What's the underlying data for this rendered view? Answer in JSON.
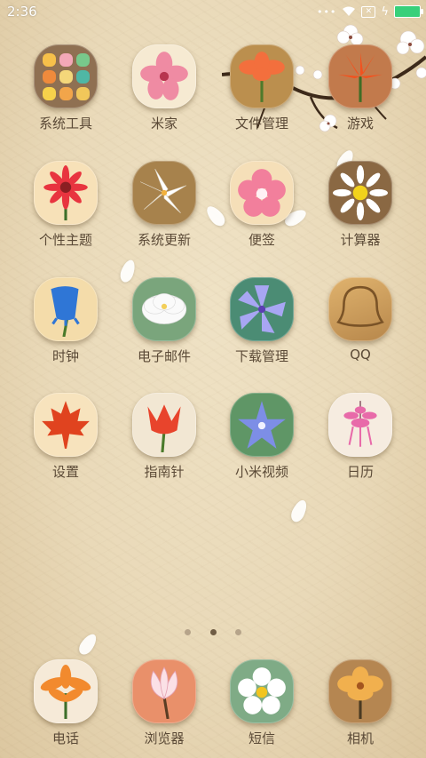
{
  "status_bar": {
    "time": "2:36",
    "signal_dots": "•••",
    "notification_glyph": "✕",
    "charging_glyph": "ϟ"
  },
  "colors": {
    "wallpaper": "#ebdcbc",
    "label_text": "#5b4a37",
    "battery": "#38d07a",
    "dot_active": "#6f5c44",
    "dot_inactive": "#b6a48a"
  },
  "apps": [
    {
      "label": "系统工具",
      "icon": "folder-icon",
      "bg": "#8f7052"
    },
    {
      "label": "米家",
      "icon": "pink-flower-icon",
      "bg": "#f6ead2"
    },
    {
      "label": "文件管理",
      "icon": "orange-flower-icon",
      "bg": "#bb8f4e"
    },
    {
      "label": "游戏",
      "icon": "orange-lily-icon",
      "bg": "#c27a4c"
    },
    {
      "label": "个性主题",
      "icon": "red-gerbera-icon",
      "bg": "#f7e1b8"
    },
    {
      "label": "系统更新",
      "icon": "white-lily-icon",
      "bg": "#a7824c"
    },
    {
      "label": "便签",
      "icon": "pink-blossom-icon",
      "bg": "#f5dfb8"
    },
    {
      "label": "计算器",
      "icon": "daisy-icon",
      "bg": "#8a6843"
    },
    {
      "label": "时钟",
      "icon": "bluebell-icon",
      "bg": "#f4dcaa"
    },
    {
      "label": "电子邮件",
      "icon": "white-peony-icon",
      "bg": "#7aa57c"
    },
    {
      "label": "下载管理",
      "icon": "purple-flower-icon",
      "bg": "#4b8c74"
    },
    {
      "label": "QQ",
      "icon": "penguin-silhouette-icon",
      "bg": "#c89c5a"
    },
    {
      "label": "设置",
      "icon": "maple-leaf-icon",
      "bg": "#f7e3bd"
    },
    {
      "label": "指南针",
      "icon": "tulip-icon",
      "bg": "#f2e7d3"
    },
    {
      "label": "小米视频",
      "icon": "star-flower-icon",
      "bg": "#5f9666"
    },
    {
      "label": "日历",
      "icon": "pink-hanging-flower-icon",
      "bg": "#f6ece0"
    }
  ],
  "dock": [
    {
      "label": "电话",
      "icon": "orange-lily-icon",
      "bg": "#f6ead8"
    },
    {
      "label": "浏览器",
      "icon": "magnolia-icon",
      "bg": "#e9906a"
    },
    {
      "label": "短信",
      "icon": "white-daisy-icon",
      "bg": "#7fab86"
    },
    {
      "label": "相机",
      "icon": "golden-flower-icon",
      "bg": "#b58651"
    }
  ],
  "page_indicator": {
    "count": 3,
    "active": 2
  }
}
